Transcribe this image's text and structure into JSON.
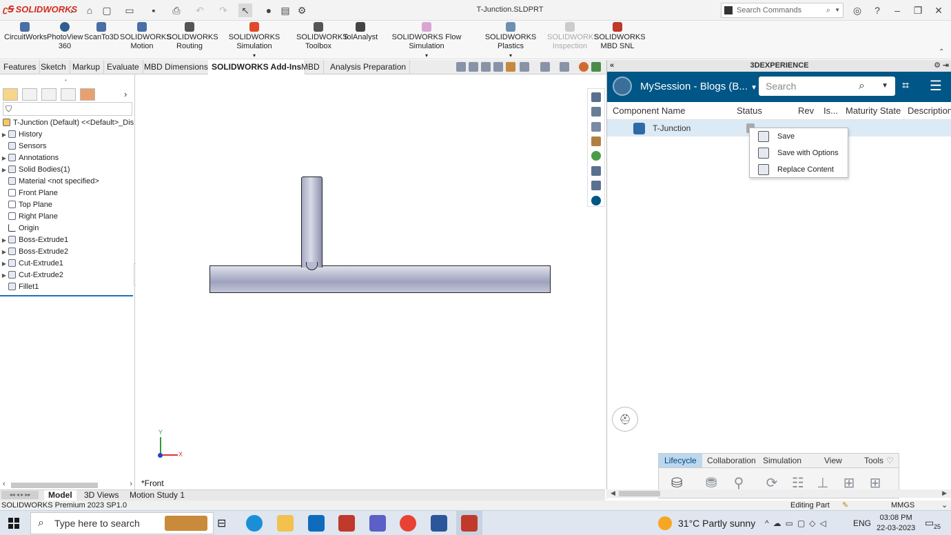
{
  "titlebar": {
    "brand": "SOLIDWORKS",
    "document_title": "T-Junction.SLDPRT",
    "search_placeholder": "Search Commands"
  },
  "command_manager": [
    {
      "label": "CircuitWorks",
      "label2": ""
    },
    {
      "label": "PhotoView",
      "label2": "360"
    },
    {
      "label": "ScanTo3D",
      "label2": ""
    },
    {
      "label": "SOLIDWORKS",
      "label2": "Motion"
    },
    {
      "label": "SOLIDWORKS",
      "label2": "Routing"
    },
    {
      "label": "SOLIDWORKS Simulation",
      "label2": ""
    },
    {
      "label": "SOLIDWORKS",
      "label2": "Toolbox"
    },
    {
      "label": "TolAnalyst",
      "label2": ""
    },
    {
      "label": "SOLIDWORKS Flow Simulation",
      "label2": ""
    },
    {
      "label": "SOLIDWORKS Plastics",
      "label2": ""
    },
    {
      "label": "SOLIDWORKS",
      "label2": "Inspection"
    },
    {
      "label": "SOLIDWORKS",
      "label2": "MBD SNL"
    }
  ],
  "tabs": [
    "Features",
    "Sketch",
    "Markup",
    "Evaluate",
    "MBD Dimensions",
    "SOLIDWORKS Add-Ins",
    "MBD",
    "Analysis Preparation"
  ],
  "active_tab": "SOLIDWORKS Add-Ins",
  "feature_tree": {
    "root": "T-Junction (Default) <<Default>_Dis",
    "items": [
      {
        "label": "History",
        "expandable": true
      },
      {
        "label": "Sensors",
        "expandable": false
      },
      {
        "label": "Annotations",
        "expandable": true
      },
      {
        "label": "Solid Bodies(1)",
        "expandable": true
      },
      {
        "label": "Material <not specified>",
        "expandable": false
      },
      {
        "label": "Front Plane",
        "expandable": false
      },
      {
        "label": "Top Plane",
        "expandable": false
      },
      {
        "label": "Right Plane",
        "expandable": false
      },
      {
        "label": "Origin",
        "expandable": false
      },
      {
        "label": "Boss-Extrude1",
        "expandable": true
      },
      {
        "label": "Boss-Extrude2",
        "expandable": true
      },
      {
        "label": "Cut-Extrude1",
        "expandable": true
      },
      {
        "label": "Cut-Extrude2",
        "expandable": true
      },
      {
        "label": "Fillet1",
        "expandable": false
      }
    ]
  },
  "viewport": {
    "view_label": "*Front",
    "axis_x": "X",
    "axis_y": "Y"
  },
  "dx_panel": {
    "title": "3DEXPERIENCE",
    "session": "MySession - Blogs (B...",
    "search_placeholder": "Search",
    "columns": [
      "Component Name",
      "Status",
      "Rev",
      "Is...",
      "Maturity State",
      "Description"
    ],
    "rows": [
      {
        "name": "T-Junction"
      }
    ],
    "context_menu": [
      "Save",
      "Save with Options",
      "Replace Content"
    ],
    "lifecycle_tabs": [
      "Lifecycle",
      "Collaboration",
      "Simulation",
      "View",
      "Tools"
    ],
    "active_lifecycle_tab": "Lifecycle"
  },
  "bottom_tabs": [
    "Model",
    "3D Views",
    "Motion Study 1"
  ],
  "active_bottom_tab": "Model",
  "status": {
    "product": "SOLIDWORKS Premium 2023 SP1.0",
    "mode": "Editing Part",
    "units": "MMGS"
  },
  "taskbar": {
    "search_placeholder": "Type here to search",
    "weather": "31°C  Partly sunny",
    "language": "ENG",
    "time": "03:08 PM",
    "date": "22-03-2023",
    "notifications": "25"
  },
  "colors": {
    "solidworks_red": "#d52b1e",
    "dx_blue": "#005686",
    "row_selected": "#dceaf5"
  }
}
